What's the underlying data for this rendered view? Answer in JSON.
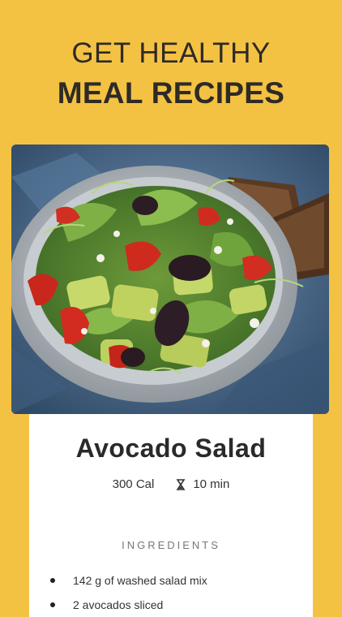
{
  "headline": {
    "line1": "GET HEALTHY",
    "line2": "MEAL RECIPES"
  },
  "recipe": {
    "title": "Avocado Salad",
    "calories": "300 Cal",
    "time": "10 min",
    "ingredients_label": "INGREDIENTS",
    "ingredients": [
      "142 g of washed salad mix",
      "2 avocados sliced"
    ]
  },
  "photo": {
    "subject": "salad-bowl-photo"
  },
  "icons": {
    "time": "timer-icon",
    "bullet": "bullet-icon"
  },
  "colors": {
    "background": "#f4c243",
    "card": "#ffffff",
    "text": "#2a2a2a"
  }
}
